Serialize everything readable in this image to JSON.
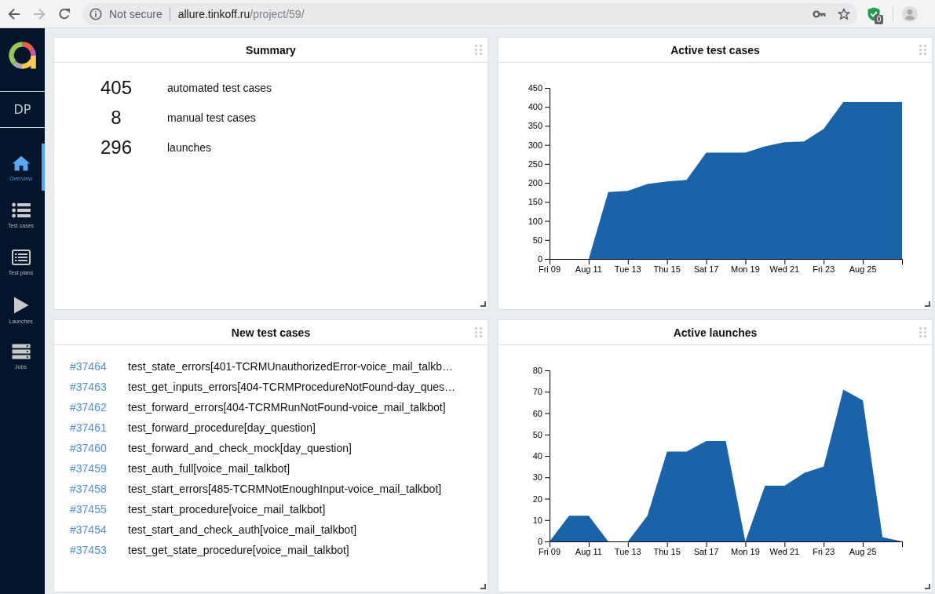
{
  "browser": {
    "security_text": "Not secure",
    "url_host": "allure.tinkoff.ru",
    "url_path": "/project/59/",
    "extension_count": "0"
  },
  "sidebar": {
    "project": "DP",
    "items": [
      {
        "label": "Overview",
        "selected": true
      },
      {
        "label": "Test cases",
        "selected": false
      },
      {
        "label": "Test plans",
        "selected": false
      },
      {
        "label": "Launches",
        "selected": false
      },
      {
        "label": "Jobs",
        "selected": false
      }
    ]
  },
  "widgets": [
    {
      "kind": "summary",
      "title": "Summary",
      "stats": [
        {
          "value": "405",
          "label": "automated test cases"
        },
        {
          "value": "8",
          "label": "manual test cases"
        },
        {
          "value": "296",
          "label": "launches"
        }
      ]
    },
    {
      "kind": "chart",
      "title": "Active test cases",
      "chart_data": {
        "type": "area",
        "x": [
          "--08-09",
          "--08-10",
          "--08-11",
          "--08-12",
          "--08-13",
          "--08-14",
          "--08-15",
          "--08-16",
          "--08-17",
          "--08-18",
          "--08-19",
          "--08-20",
          "--08-21",
          "--08-22",
          "--08-23",
          "--08-24",
          "--08-25",
          "--08-26",
          "--08-27"
        ],
        "values": [
          0,
          0,
          0,
          176,
          179,
          197,
          204,
          208,
          280,
          280,
          280,
          296,
          307,
          309,
          342,
          413,
          413,
          413,
          413
        ],
        "color": "#1a63a9",
        "xlim": [
          "--08-09",
          "--08-27"
        ],
        "ylim": [
          0,
          450
        ],
        "xticks": [
          {
            "value": "--08-09",
            "label": "Fri 09"
          },
          {
            "value": "--08-11",
            "label": "Aug 11"
          },
          {
            "value": "--08-13",
            "label": "Tue 13"
          },
          {
            "value": "--08-15",
            "label": "Thu 15"
          },
          {
            "value": "--08-17",
            "label": "Sat 17"
          },
          {
            "value": "--08-19",
            "label": "Mon 19"
          },
          {
            "value": "--08-21",
            "label": "Wed 21"
          },
          {
            "value": "--08-23",
            "label": "Fri 23"
          },
          {
            "value": "--08-25",
            "label": "Aug 25"
          }
        ],
        "yticks": [
          0,
          50,
          100,
          150,
          200,
          250,
          300,
          350,
          400,
          450
        ]
      }
    },
    {
      "kind": "list",
      "title": "New test cases",
      "items": [
        {
          "id": "#37464",
          "name": "test_state_errors[401-TCRMUnauthorizedError-voice_mail_talkb…"
        },
        {
          "id": "#37463",
          "name": "test_get_inputs_errors[404-TCRMProcedureNotFound-day_ques…"
        },
        {
          "id": "#37462",
          "name": "test_forward_errors[404-TCRMRunNotFound-voice_mail_talkbot]"
        },
        {
          "id": "#37461",
          "name": "test_forward_procedure[day_question]"
        },
        {
          "id": "#37460",
          "name": "test_forward_and_check_mock[day_question]"
        },
        {
          "id": "#37459",
          "name": "test_auth_full[voice_mail_talkbot]"
        },
        {
          "id": "#37458",
          "name": "test_start_errors[485-TCRMNotEnoughInput-voice_mail_talkbot]"
        },
        {
          "id": "#37455",
          "name": "test_start_procedure[voice_mail_talkbot]"
        },
        {
          "id": "#37454",
          "name": "test_start_and_check_auth[voice_mail_talkbot]"
        },
        {
          "id": "#37453",
          "name": "test_get_state_procedure[voice_mail_talkbot]"
        }
      ]
    },
    {
      "kind": "chart",
      "title": "Active launches",
      "chart_data": {
        "type": "area",
        "x": [
          "--08-09",
          "--08-10",
          "--08-11",
          "--08-12",
          "--08-13",
          "--08-14",
          "--08-15",
          "--08-16",
          "--08-17",
          "--08-18",
          "--08-19",
          "--08-20",
          "--08-21",
          "--08-22",
          "--08-23",
          "--08-24",
          "--08-25",
          "--08-26",
          "--08-27"
        ],
        "values": [
          0,
          12,
          12,
          0,
          0,
          12,
          42,
          42,
          47,
          47,
          0,
          26,
          26,
          32,
          35,
          71,
          66,
          2,
          0
        ],
        "color": "#1a63a9",
        "xlim": [
          "--08-09",
          "--08-27"
        ],
        "ylim": [
          0,
          80
        ],
        "xticks": [
          {
            "value": "--08-09",
            "label": "Fri 09"
          },
          {
            "value": "--08-11",
            "label": "Aug 11"
          },
          {
            "value": "--08-13",
            "label": "Tue 13"
          },
          {
            "value": "--08-15",
            "label": "Thu 15"
          },
          {
            "value": "--08-17",
            "label": "Sat 17"
          },
          {
            "value": "--08-19",
            "label": "Mon 19"
          },
          {
            "value": "--08-21",
            "label": "Wed 21"
          },
          {
            "value": "--08-23",
            "label": "Fri 23"
          },
          {
            "value": "--08-25",
            "label": "Aug 25"
          }
        ],
        "yticks": [
          0,
          10,
          20,
          30,
          40,
          50,
          60,
          70,
          80
        ]
      }
    }
  ]
}
